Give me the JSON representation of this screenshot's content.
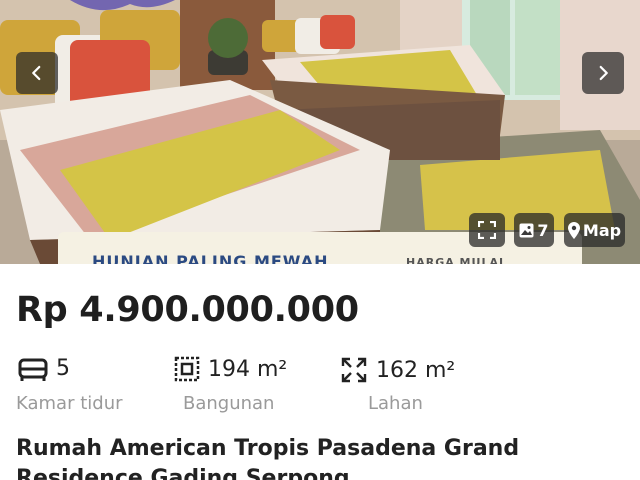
{
  "gallery": {
    "banner_text": "HUNIAN PALING MEWAH",
    "banner_subtext": "HARGA MULAI",
    "photo_count": "7",
    "map_label": "Map",
    "icons": {
      "prev": "chevron-left-icon",
      "next": "chevron-right-icon",
      "expand": "fullscreen-icon",
      "photos": "image-icon",
      "map": "map-pin-icon"
    }
  },
  "listing": {
    "price": "Rp 4.900.000.000",
    "specs": {
      "bedrooms": {
        "value": "5",
        "label": "Kamar tidur",
        "icon": "bed-icon"
      },
      "building": {
        "value": "194 m²",
        "label": "Bangunan",
        "icon": "floor-plan-icon"
      },
      "land": {
        "value": "162 m²",
        "label": "Lahan",
        "icon": "expand-arrows-icon"
      }
    },
    "title": "Rumah American Tropis Pasadena Grand Residence Gading Serpong"
  }
}
